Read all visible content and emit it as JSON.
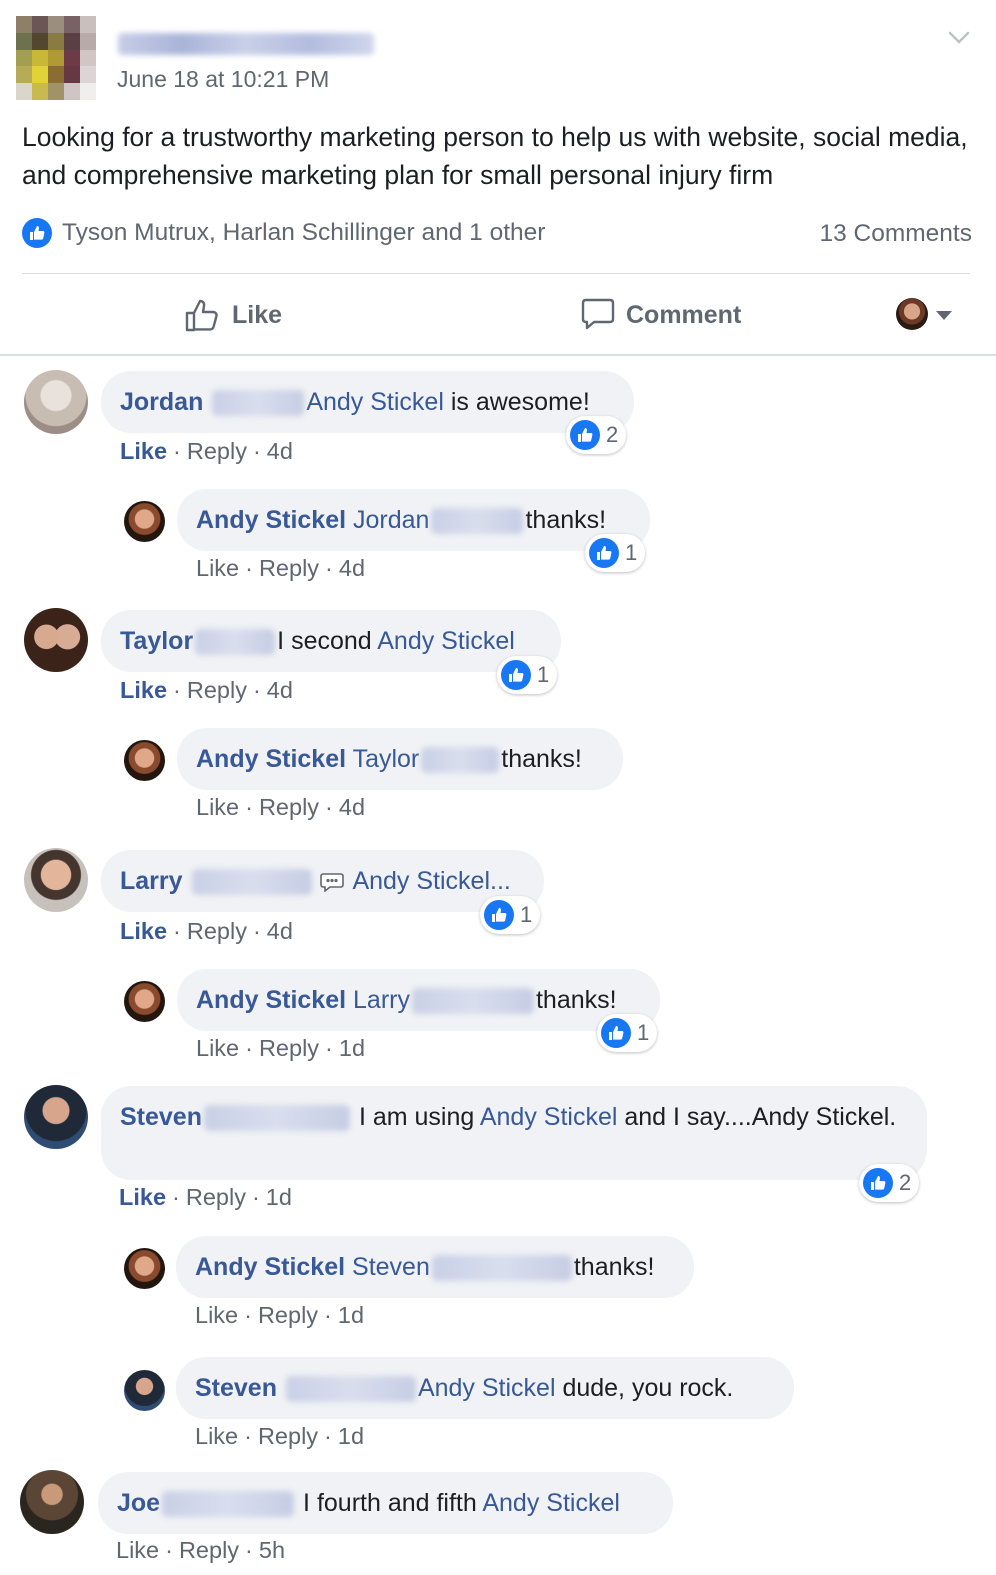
{
  "post": {
    "date": "June 18 at 10:21 PM",
    "text": "Looking for a trustworthy marketing person to help us with website, social media, and comprehensive marketing plan for small personal injury firm",
    "reactions_text": "Tyson Mutrux, Harlan Schillinger and 1 other",
    "comments_count": "13 Comments"
  },
  "actions": {
    "like": "Like",
    "comment": "Comment"
  },
  "meta_labels": {
    "like": "Like",
    "reply": "Reply",
    "sep": "·"
  },
  "comments": [
    {
      "author": "Jordan",
      "mention": "Andy Stickel",
      "text": " is awesome!",
      "time": "4d",
      "likes": "2"
    },
    {
      "author": "Andy Stickel",
      "mention": "Jordan",
      "text": "thanks!",
      "time": "4d",
      "likes": "1"
    },
    {
      "author": "Taylor",
      "text": "I second ",
      "mention": "Andy Stickel",
      "time": "4d",
      "likes": "1"
    },
    {
      "author": "Andy Stickel",
      "mention": "Taylor",
      "text": "thanks!",
      "time": "4d"
    },
    {
      "author": "Larry",
      "mention": "Andy Stickel...",
      "time": "4d",
      "likes": "1"
    },
    {
      "author": "Andy Stickel",
      "mention": "Larry",
      "text": "thanks!",
      "time": "1d",
      "likes": "1"
    },
    {
      "author": "Steven",
      "text1": "I am using ",
      "mention": "Andy Stickel",
      "text2": " and I say....Andy Stickel.",
      "time": "1d",
      "likes": "2"
    },
    {
      "author": "Andy Stickel",
      "mention": "Steven",
      "text": "thanks!",
      "time": "1d"
    },
    {
      "author": "Steven",
      "mention": "Andy Stickel",
      "text": " dude, you rock.",
      "time": "1d"
    },
    {
      "author": "Joe",
      "text": "I fourth and fifth ",
      "mention": "Andy Stickel",
      "time": "5h"
    }
  ],
  "colors": {
    "link": "#385898",
    "accent": "#1877f2",
    "bubble": "#f0f2f5",
    "muted": "#606770"
  },
  "icons": [
    "thumbs-up-icon",
    "comment-icon",
    "chevron-down-icon",
    "caret-down-icon",
    "speech-bubble-emoji-icon"
  ]
}
